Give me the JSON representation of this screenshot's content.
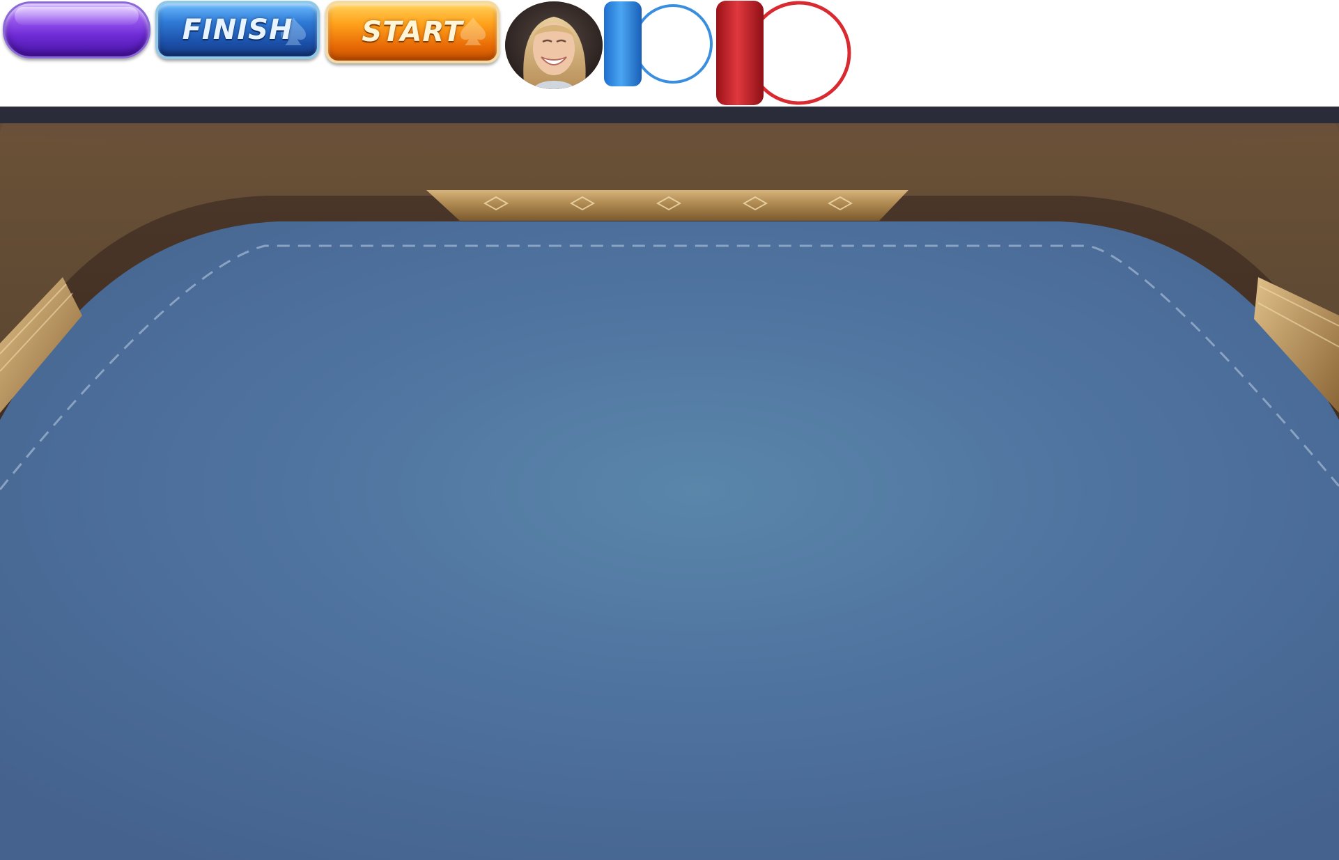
{
  "asset_strip": {
    "purple_button": {
      "label": ""
    },
    "finish_button": {
      "label": "FINISH"
    },
    "start_button": {
      "label": "START"
    },
    "avatar": {
      "icon": "player-avatar-photo"
    },
    "toggle_blue": {
      "color": "#2f86e0",
      "icon": "toggle-off-icon"
    },
    "toggle_red": {
      "color": "#cc1f26",
      "icon": "toggle-off-icon"
    }
  },
  "table": {
    "felt_color": "#4b6a98",
    "felt_highlight_color": "#5a86aa",
    "rail_color": "#5a4530",
    "trim_color": "#b8955e",
    "dashed_line_color": "#9fb6d2"
  }
}
